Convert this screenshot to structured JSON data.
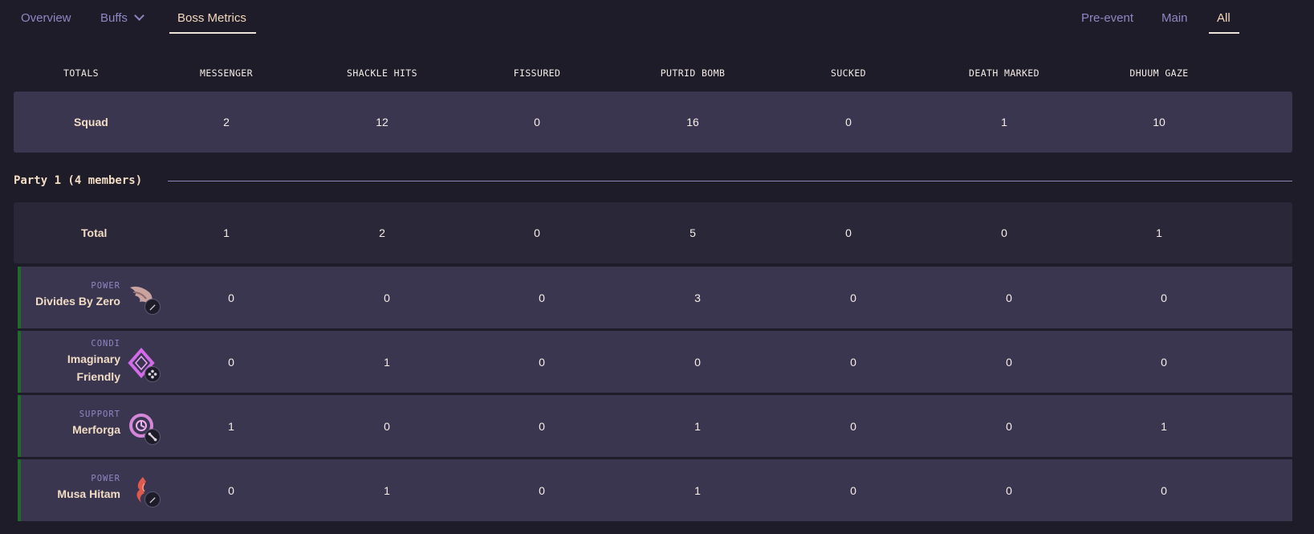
{
  "nav": {
    "left_tabs": [
      "Overview",
      "Buffs",
      "Boss Metrics"
    ],
    "right_tabs": [
      "Pre-event",
      "Main",
      "All"
    ],
    "active_left": "Boss Metrics",
    "active_right": "All"
  },
  "table": {
    "headers": [
      "TOTALS",
      "MESSENGER",
      "SHACKLE HITS",
      "FISSURED",
      "PUTRID BOMB",
      "SUCKED",
      "DEATH MARKED",
      "DHUUM GAZE"
    ],
    "squad": {
      "label": "Squad",
      "values": [
        "2",
        "12",
        "0",
        "16",
        "0",
        "1",
        "10"
      ]
    },
    "party_title": "Party 1 (4 members)",
    "party_total": {
      "label": "Total",
      "values": [
        "1",
        "2",
        "0",
        "5",
        "0",
        "0",
        "1"
      ]
    },
    "players": [
      {
        "role": "POWER",
        "name": "Divides By Zero",
        "values": [
          "0",
          "0",
          "0",
          "3",
          "0",
          "0",
          "0"
        ],
        "profession_icon": "winged-profession-icon",
        "spec_icon": "pencil-icon",
        "color": "#c9a3a0"
      },
      {
        "role": "CONDI",
        "name": "Imaginary Friendly",
        "values": [
          "0",
          "1",
          "0",
          "0",
          "0",
          "0",
          "0"
        ],
        "profession_icon": "mesmer-diamond-icon",
        "spec_icon": "dots-icon",
        "color": "#d36ae8"
      },
      {
        "role": "SUPPORT",
        "name": "Merforga",
        "values": [
          "1",
          "0",
          "0",
          "1",
          "0",
          "0",
          "1"
        ],
        "profession_icon": "clockwork-profession-icon",
        "spec_icon": "bone-icon",
        "color": "#d487d9"
      },
      {
        "role": "POWER",
        "name": "Musa Hitam",
        "values": [
          "0",
          "1",
          "0",
          "1",
          "0",
          "0",
          "0"
        ],
        "profession_icon": "flame-profession-icon",
        "spec_icon": "pencil-icon",
        "color": "#e05a4c"
      }
    ]
  },
  "colors": {
    "background": "#1e1c29",
    "row_bg": "#3a3650",
    "total_row_bg": "#2a2739",
    "accent_text": "#f2dcc4",
    "muted_text": "#8f87c4",
    "party_stripe": "#1f6b2c"
  }
}
